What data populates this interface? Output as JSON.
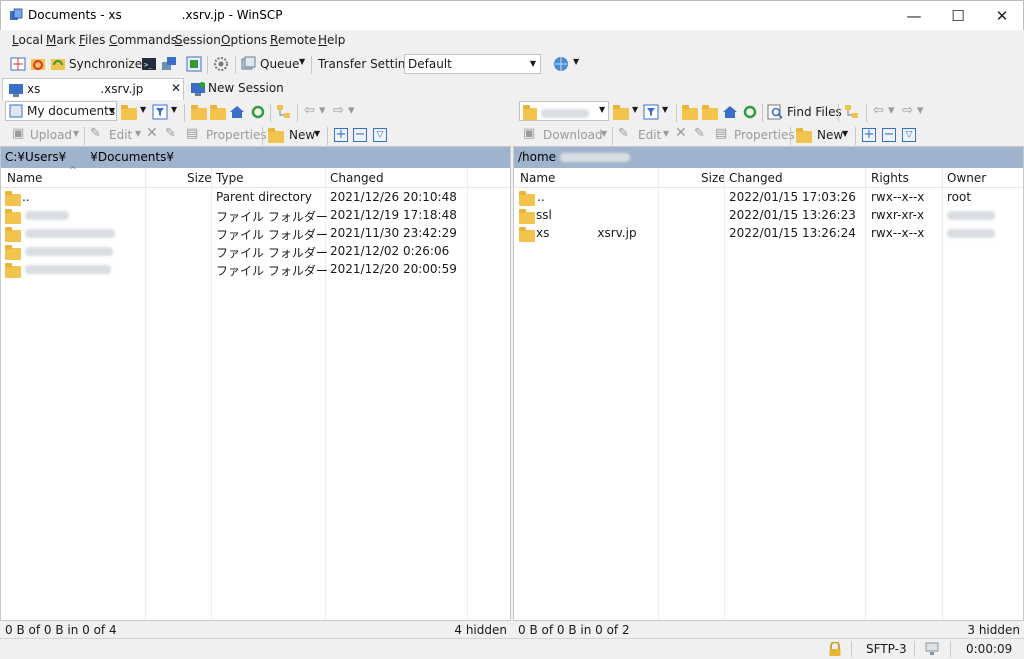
{
  "window": {
    "title": "Documents - xs     .xsrv.jp - WinSCP",
    "minimize": "—",
    "maximize": "☐",
    "close": "✕"
  },
  "menu": [
    "Local",
    "Mark",
    "Files",
    "Commands",
    "Session",
    "Options",
    "Remote",
    "Help"
  ],
  "toolbar": {
    "synchronize": "Synchronize",
    "queue": "Queue",
    "transfer_settings_label": "Transfer Settings",
    "transfer_settings_value": "Default"
  },
  "tabs": {
    "session_tab": "xs     .xsrv.jp",
    "new_session": "New Session"
  },
  "left": {
    "location": "My documents",
    "upload": "Upload",
    "edit": "Edit",
    "properties": "Properties",
    "new": "New",
    "path": "C:¥Users¥  ¥Documents¥",
    "columns": {
      "name": "Name",
      "size": "Size",
      "type": "Type",
      "changed": "Changed"
    },
    "rows": [
      {
        "name": "..",
        "type": "Parent directory",
        "changed": "2021/12/26  20:10:48"
      },
      {
        "name": "",
        "type": "ファイル フォルダー",
        "changed": "2021/12/19  17:18:48"
      },
      {
        "name": "",
        "type": "ファイル フォルダー",
        "changed": "2021/11/30  23:42:29"
      },
      {
        "name": "",
        "type": "ファイル フォルダー",
        "changed": "2021/12/02  0:26:06"
      },
      {
        "name": "",
        "type": "ファイル フォルダー",
        "changed": "2021/12/20  20:00:59"
      }
    ],
    "status": "0 B of 0 B in 0 of 4",
    "hidden": "4 hidden"
  },
  "right": {
    "find_files": "Find Files",
    "download": "Download",
    "edit": "Edit",
    "properties": "Properties",
    "new": "New",
    "path": "/home",
    "columns": {
      "name": "Name",
      "size": "Size",
      "changed": "Changed",
      "rights": "Rights",
      "owner": "Owner"
    },
    "rows": [
      {
        "name": "..",
        "changed": "2022/01/15 17:03:26",
        "rights": "rwx--x--x",
        "owner": "root"
      },
      {
        "name": "ssl",
        "changed": "2022/01/15 13:26:23",
        "rights": "rwxr-xr-x",
        "owner": ""
      },
      {
        "name": "xs    xsrv.jp",
        "changed": "2022/01/15 13:26:24",
        "rights": "rwx--x--x",
        "owner": ""
      }
    ],
    "status": "0 B of 0 B in 0 of 2",
    "hidden": "3 hidden"
  },
  "bottom": {
    "protocol": "SFTP-3",
    "elapsed": "0:00:09"
  },
  "colors": {
    "path_bar": "#9fb4cc",
    "folder": "#f2c44e",
    "accent_blue": "#1e63b8",
    "refresh_green": "#2e9d36"
  }
}
